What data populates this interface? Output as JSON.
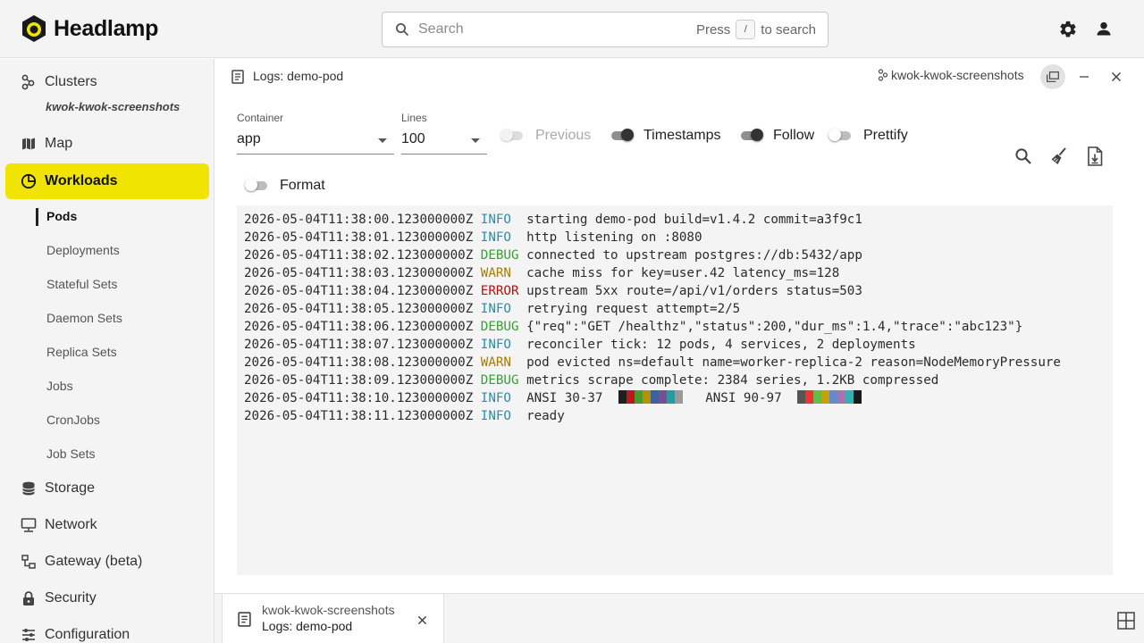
{
  "app": {
    "name": "Headlamp"
  },
  "search": {
    "placeholder": "Search",
    "hint_prefix": "Press",
    "hint_key": "/",
    "hint_suffix": "to search"
  },
  "sidebar": {
    "clusters_label": "Clusters",
    "cluster_name": "kwok-kwok-screenshots",
    "items": [
      {
        "label": "Map",
        "icon": "map-icon"
      },
      {
        "label": "Workloads",
        "icon": "workloads-icon",
        "active": true
      },
      {
        "label": "Storage",
        "icon": "storage-icon"
      },
      {
        "label": "Network",
        "icon": "network-icon"
      },
      {
        "label": "Gateway (beta)",
        "icon": "gateway-icon"
      },
      {
        "label": "Security",
        "icon": "lock-icon"
      },
      {
        "label": "Configuration",
        "icon": "configuration-icon"
      }
    ],
    "workloads_sub": [
      "Pods",
      "Deployments",
      "Stateful Sets",
      "Daemon Sets",
      "Replica Sets",
      "Jobs",
      "CronJobs",
      "Job Sets"
    ]
  },
  "panel": {
    "title": "Logs: demo-pod",
    "cluster": "kwok-kwok-screenshots",
    "container_label": "Container",
    "container_value": "app",
    "lines_label": "Lines",
    "lines_value": "100",
    "toggles": {
      "previous": "Previous",
      "timestamps": "Timestamps",
      "follow": "Follow",
      "prettify": "Prettify",
      "format": "Format"
    }
  },
  "logs": [
    {
      "ts": "2026-05-04T11:38:00.123000000Z",
      "level": "INFO",
      "msg": "starting demo-pod build=v1.4.2 commit=a3f9c1"
    },
    {
      "ts": "2026-05-04T11:38:01.123000000Z",
      "level": "INFO",
      "msg": "http listening on :8080"
    },
    {
      "ts": "2026-05-04T11:38:02.123000000Z",
      "level": "DEBUG",
      "msg": "connected to upstream postgres://db:5432/app"
    },
    {
      "ts": "2026-05-04T11:38:03.123000000Z",
      "level": "WARN",
      "msg": "cache miss for key=user.42 latency_ms=128"
    },
    {
      "ts": "2026-05-04T11:38:04.123000000Z",
      "level": "ERROR",
      "msg": "upstream 5xx route=/api/v1/orders status=503"
    },
    {
      "ts": "2026-05-04T11:38:05.123000000Z",
      "level": "INFO",
      "msg": "retrying request attempt=2/5"
    },
    {
      "ts": "2026-05-04T11:38:06.123000000Z",
      "level": "DEBUG",
      "msg": "{\"req\":\"GET /healthz\",\"status\":200,\"dur_ms\":1.4,\"trace\":\"abc123\"}"
    },
    {
      "ts": "2026-05-04T11:38:07.123000000Z",
      "level": "INFO",
      "msg": "reconciler tick: 12 pods, 4 services, 2 deployments"
    },
    {
      "ts": "2026-05-04T11:38:08.123000000Z",
      "level": "WARN",
      "msg": "pod evicted ns=default name=worker-replica-2 reason=NodeMemoryPressure"
    },
    {
      "ts": "2026-05-04T11:38:09.123000000Z",
      "level": "DEBUG",
      "msg": "metrics scrape complete: 2384 series, 1.2KB compressed"
    },
    {
      "ts": "2026-05-04T11:38:10.123000000Z",
      "level": "INFO",
      "msg": "ANSI 30-37",
      "swatches_a": [
        "#1f1f1f",
        "#c0171f",
        "#4c9a2a",
        "#b59200",
        "#3f5f9f",
        "#7a4f8f",
        "#2b9aa0",
        "#9a9a9a"
      ],
      "msg2": "ANSI 90-97",
      "swatches_b": [
        "#555555",
        "#ee3333",
        "#66bb44",
        "#c8a000",
        "#6688cc",
        "#b070b0",
        "#33b0b0",
        "#1a1a1a"
      ]
    },
    {
      "ts": "2026-05-04T11:38:11.123000000Z",
      "level": "INFO",
      "msg": "ready"
    }
  ],
  "dock": {
    "tab_cluster": "kwok-kwok-screenshots",
    "tab_title": "Logs: demo-pod"
  },
  "colors": {
    "accent": "#f0e400",
    "sidebar_bg": "#f4f4f4"
  }
}
